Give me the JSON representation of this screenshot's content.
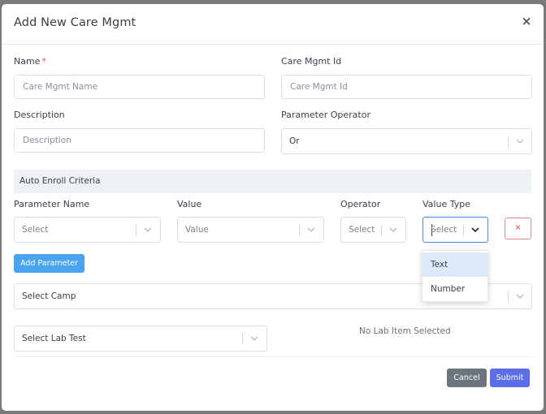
{
  "modal": {
    "title": "Add New Care Mgmt",
    "close_label": "×"
  },
  "form": {
    "name": {
      "label": "Name",
      "required_mark": "*",
      "placeholder": "Care Mgmt Name",
      "value": ""
    },
    "care_mgmt_id": {
      "label": "Care Mgmt Id",
      "placeholder": "Care Mgmt Id",
      "value": ""
    },
    "description": {
      "label": "Description",
      "placeholder": "Description",
      "value": ""
    },
    "parameter_operator": {
      "label": "Parameter Operator",
      "value": "Or"
    }
  },
  "auto_enroll": {
    "section_title": "Auto Enroll Criteria",
    "columns": {
      "parameter_name": "Parameter Name",
      "value": "Value",
      "operator": "Operator",
      "value_type": "Value Type"
    },
    "row": {
      "parameter_name": "Select",
      "value": "Value",
      "operator": "Select",
      "value_type": "Select",
      "remove_label": "×"
    },
    "value_type_options": [
      "Text",
      "Number"
    ],
    "highlighted_option": "Text",
    "add_parameter_label": "Add Parameter"
  },
  "camp": {
    "placeholder": "Select Camp"
  },
  "lab_test": {
    "placeholder": "Select Lab Test",
    "empty_text": "No Lab Item Selected"
  },
  "footer": {
    "cancel_label": "Cancel",
    "submit_label": "Submit"
  },
  "colors": {
    "primary": "#4aa3ef",
    "submit": "#5b6ee8",
    "cancel": "#6c757d",
    "danger": "#e24b4b",
    "focus": "#3f8de8"
  },
  "icons": {
    "close": "close-icon",
    "chevron": "chevron-down-icon"
  }
}
